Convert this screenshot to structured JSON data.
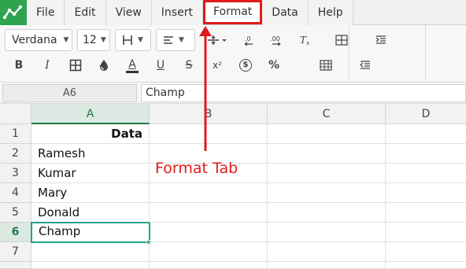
{
  "menubar": {
    "items": [
      "File",
      "Edit",
      "View",
      "Insert",
      "Format",
      "Data",
      "Help"
    ],
    "active": "Format"
  },
  "toolbar": {
    "font_family": "Verdana",
    "font_size": "12",
    "bold_label": "B",
    "italic_label": "I",
    "font_color_label": "A",
    "underline_label": "U",
    "strike_label": "S",
    "superscript_label": "x²",
    "currency_label": "$",
    "percent_label": "%",
    "icons": [
      "borders-icon",
      "fill-color-icon",
      "align-icon",
      "valign-icon",
      "decrease-decimal-icon",
      "increase-decimal-icon",
      "clear-format-icon",
      "table-icon",
      "indent-icon"
    ]
  },
  "formula_bar": {
    "cell_ref": "A6",
    "value": "Champ"
  },
  "grid": {
    "columns": [
      "A",
      "B",
      "C",
      "D"
    ],
    "rows": [
      "1",
      "2",
      "3",
      "4",
      "5",
      "6",
      "7"
    ],
    "cells": {
      "A1": "Data",
      "A2": "Ramesh",
      "A3": "Kumar",
      "A4": "Mary",
      "A5": "Donald",
      "A6": "Champ"
    },
    "selected_column": "A",
    "selected_row": "6"
  },
  "annotation": {
    "text": "Format Tab",
    "color": "#e01b1b"
  },
  "colors": {
    "brand": "#2ea44f",
    "selection": "#22a386",
    "header_selected": "#1e7a46"
  }
}
